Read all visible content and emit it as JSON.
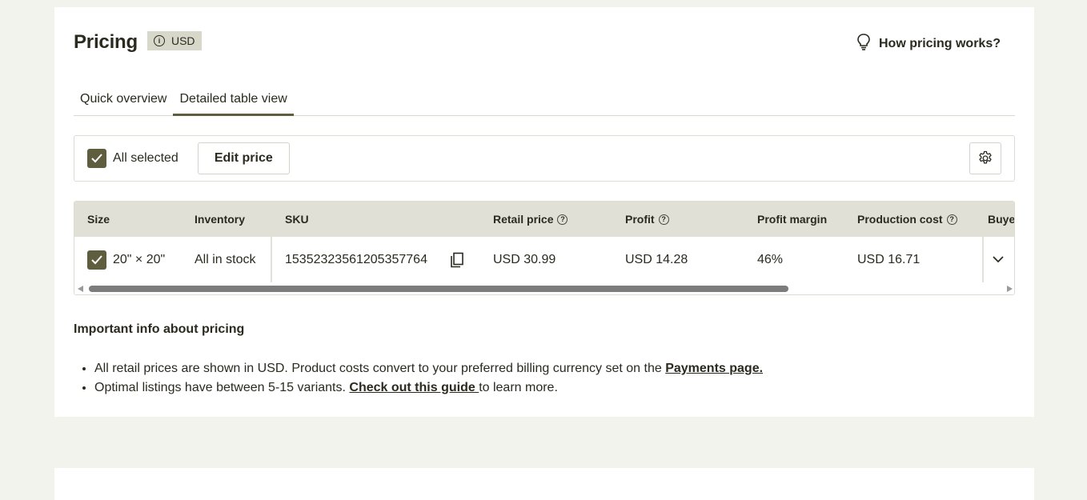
{
  "header": {
    "title": "Pricing",
    "currency_badge": "USD",
    "help_link": "How pricing works?"
  },
  "tabs": [
    {
      "label": "Quick overview",
      "active": false
    },
    {
      "label": "Detailed table view",
      "active": true
    }
  ],
  "toolbar": {
    "select_label": "All selected",
    "edit_price_label": "Edit price"
  },
  "table": {
    "columns": [
      "Size",
      "Inventory",
      "SKU",
      "Retail price",
      "Profit",
      "Profit margin",
      "Production cost",
      "Buye"
    ],
    "rows": [
      {
        "size": "20\" × 20\"",
        "inventory": "All in stock",
        "sku": "15352323561205357764",
        "retail_price": "USD 30.99",
        "profit": "USD 14.28",
        "profit_margin": "46%",
        "production_cost": "USD 16.71"
      }
    ]
  },
  "info": {
    "title": "Important info about pricing",
    "bullet1_text": "All retail prices are shown in USD. Product costs convert to your preferred billing currency set on the ",
    "bullet1_link": "Payments page.",
    "bullet2_text": "Optimal listings have between 5-15 variants. ",
    "bullet2_link": "Check out this guide ",
    "bullet2_suffix": "to learn more."
  },
  "colors": {
    "accent": "#5e5e3f",
    "page_bg": "#f3f3ee",
    "table_header_bg": "#e0e0d6",
    "badge_bg": "#d8d8ca"
  },
  "icons": [
    "info-icon",
    "lightbulb-icon",
    "checkmark-icon",
    "gear-icon",
    "help-icon",
    "copy-icon",
    "chevron-down-icon"
  ]
}
